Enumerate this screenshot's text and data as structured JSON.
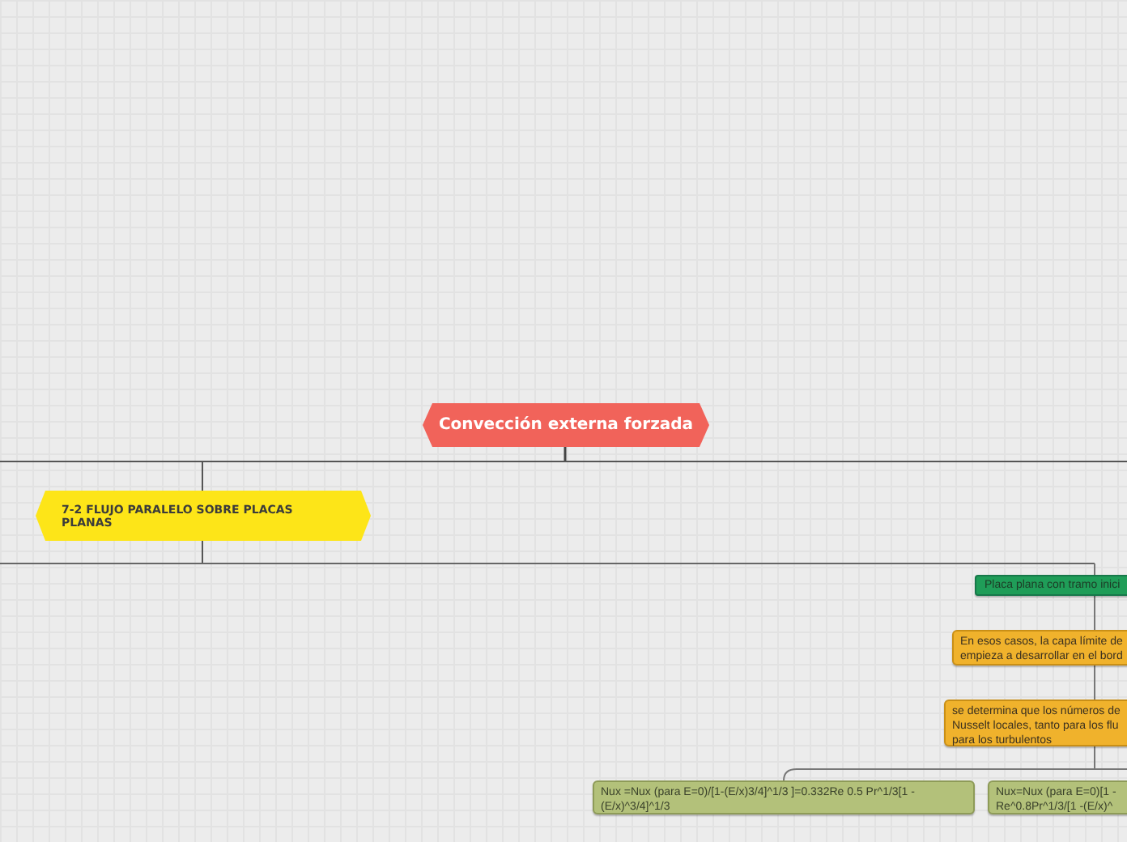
{
  "root": {
    "label": "Convección externa forzada"
  },
  "branch": {
    "label": "7-2 FLUJO PARALELO SOBRE PLACAS PLANAS"
  },
  "nodes": [
    {
      "kind": "topic",
      "lines": [
        "Placa plana con tramo inici"
      ]
    },
    {
      "kind": "detail",
      "lines": [
        "En esos casos, la capa límite de",
        "empieza a desarrollar en el bord"
      ]
    },
    {
      "kind": "detail",
      "lines": [
        "se determina que los números de",
        "Nusselt locales, tanto para los flu",
        "para los turbulentos"
      ]
    },
    {
      "kind": "formula",
      "lines": [
        "Nux =Nux (para E=0)/[1-(E/x)3/4]^1/3 ]=0.332Re 0.5 Pr^1/3[1 -",
        "(E/x)^3/4]^1/3"
      ]
    },
    {
      "kind": "formula",
      "lines": [
        "Nux=Nux (para E=0)[1 -",
        "Re^0.8Pr^1/3/[1 -(E/x)^"
      ]
    }
  ]
}
